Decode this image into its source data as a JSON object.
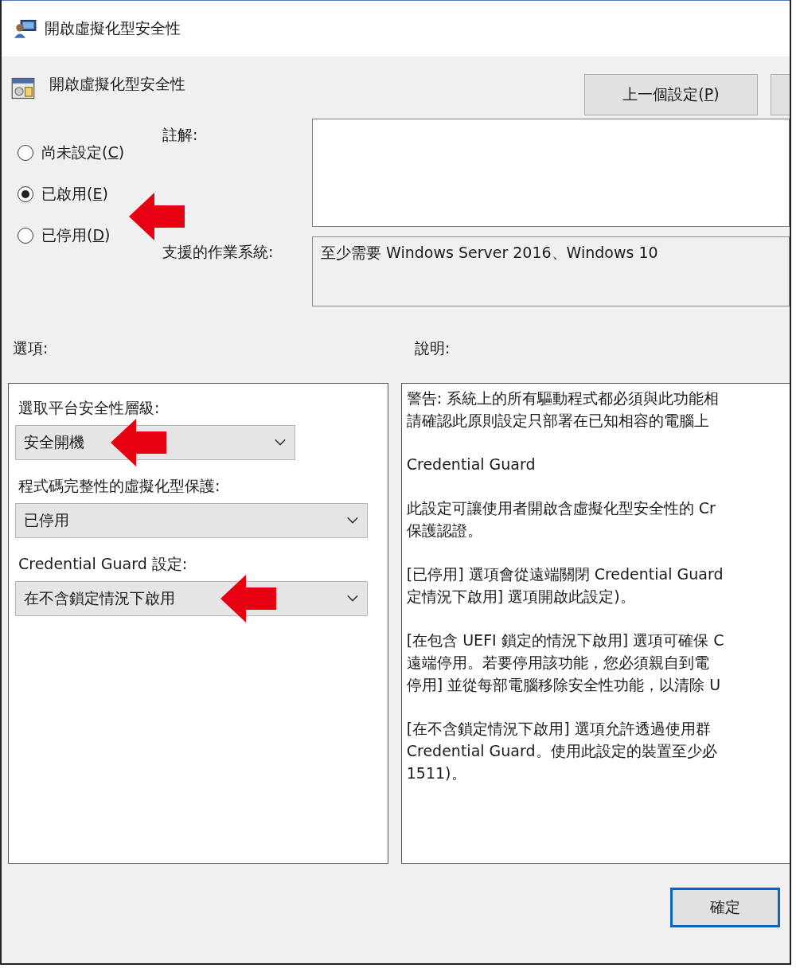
{
  "window": {
    "title": "開啟虛擬化型安全性"
  },
  "header": {
    "title": "開啟虛擬化型安全性"
  },
  "nav_buttons": [
    {
      "text_before": "上一個設定(",
      "mnemonic": "P",
      "text_after": ")"
    },
    {
      "kind": "cut"
    }
  ],
  "states": [
    {
      "text_before": "尚未設定(",
      "mnemonic": "C",
      "text_after": ")",
      "selected": false
    },
    {
      "text_before": "已啟用(",
      "mnemonic": "E",
      "text_after": ")",
      "selected": true
    },
    {
      "text_before": "已停用(",
      "mnemonic": "D",
      "text_after": ")",
      "selected": false
    }
  ],
  "comment": {
    "label": "註解:"
  },
  "supported": {
    "label": "支援的作業系統:",
    "value": "至少需要 Windows Server 2016、Windows 10"
  },
  "options": {
    "label": "選項:",
    "fields": [
      {
        "label": "選取平台安全性層級:",
        "value": "安全開機",
        "wide": false
      },
      {
        "label": "程式碼完整性的虛擬化型保護:",
        "value": "已停用",
        "wide": true
      },
      {
        "label": "Credential Guard 設定:",
        "value": "在不含鎖定情況下啟用",
        "wide": true
      }
    ]
  },
  "help": {
    "label": "說明:",
    "paragraphs": [
      [
        "警告: 系統上的所有驅動程式都必須與此功能相",
        "請確認此原則設定只部署在已知相容的電腦上"
      ],
      [
        "Credential Guard"
      ],
      [
        "此設定可讓使用者開啟含虛擬化型安全性的 Cr",
        "保護認證。"
      ],
      [
        "[已停用] 選項會從遠端關閉 Credential Guard",
        "定情況下啟用] 選項開啟此設定)。"
      ],
      [
        "[在包含 UEFI 鎖定的情況下啟用] 選項可確保 C",
        "遠端停用。若要停用該功能，您必須親自到電",
        "停用] 並從每部電腦移除安全性功能，以清除 U"
      ],
      [
        "[在不含鎖定情況下啟用] 選項允許透過使用群",
        "Credential Guard。使用此設定的裝置至少必",
        "1511)。"
      ]
    ]
  },
  "ok_button": {
    "label": "確定"
  }
}
